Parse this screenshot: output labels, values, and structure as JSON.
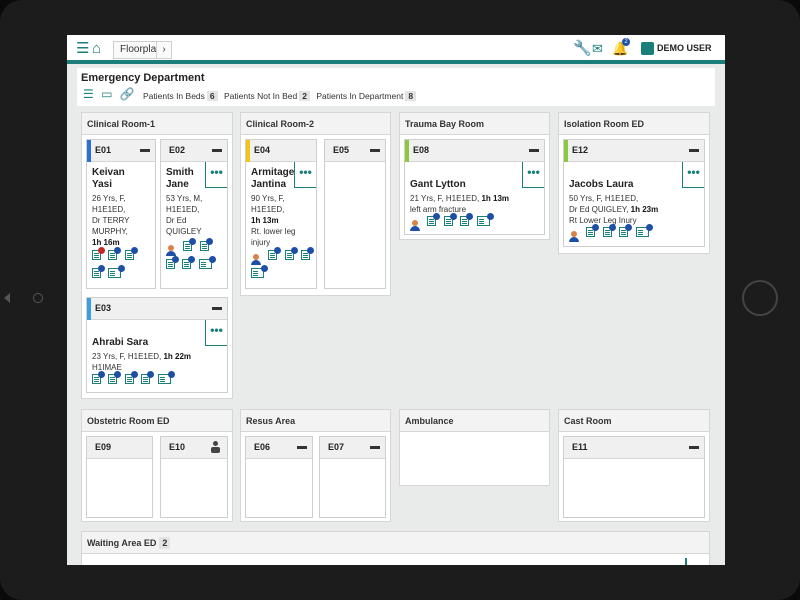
{
  "topbar": {
    "breadcrumb": "Floorplan",
    "breadcrumb_arrow": "›",
    "notification_count": "2",
    "user": "DEMO USER"
  },
  "department": {
    "title": "Emergency Department"
  },
  "stats": [
    {
      "label": "Patients In Beds",
      "count": "6"
    },
    {
      "label": "Patients Not In Bed",
      "count": "2"
    },
    {
      "label": "Patients In Department",
      "count": "8"
    }
  ],
  "rooms": {
    "clinical1": {
      "name": "Clinical Room-1"
    },
    "clinical2": {
      "name": "Clinical Room-2"
    },
    "trauma": {
      "name": "Trauma Bay Room"
    },
    "isolation": {
      "name": "Isolation Room ED"
    },
    "obstetric": {
      "name": "Obstetric Room ED"
    },
    "resus": {
      "name": "Resus Area"
    },
    "ambulance": {
      "name": "Ambulance"
    },
    "cast": {
      "name": "Cast Room"
    },
    "waiting": {
      "name": "Waiting Area ED",
      "count": "2"
    }
  },
  "beds": {
    "E01": {
      "code": "E01",
      "color": "#2c6fd6",
      "name1": "Keivan",
      "name2": "Yasi",
      "info": [
        "26 Yrs, F,",
        "H1E1ED,",
        "Dr TERRY",
        "MURPHY,"
      ],
      "time": "1h 16m"
    },
    "E02": {
      "code": "E02",
      "name1": "Smith",
      "name2": "Jane",
      "info": [
        "53 Yrs, M,",
        "H1E1ED,",
        "Dr Ed",
        "QUIGLEY"
      ]
    },
    "E03": {
      "code": "E03",
      "color": "#3d9fe0",
      "name1": "Ahrabi Sara",
      "info_prefix": "23 Yrs, F, H1E1ED,",
      "time": "1h 22m",
      "info_line2": "H1IMAE"
    },
    "E04": {
      "code": "E04",
      "color": "#f2c417",
      "name1": "Armitage",
      "name2": "Jantina",
      "info": [
        "90 Yrs, F,",
        "H1E1ED,"
      ],
      "time": "1h 13m",
      "info2": [
        "Rt. lower leg",
        "injury"
      ]
    },
    "E05": {
      "code": "E05"
    },
    "E08": {
      "code": "E08",
      "color": "#8dc63f",
      "name1": "Gant Lytton",
      "info_prefix": "21 Yrs, F, H1E1ED,",
      "time": "1h 13m",
      "info_line2": "left arm fracture"
    },
    "E12": {
      "code": "E12",
      "color": "#8dc63f",
      "name1": "Jacobs Laura",
      "info_line1": "50 Yrs, F, H1E1ED,",
      "info_prefix": "Dr Ed QUIGLEY,",
      "time": "1h 23m",
      "info_line3": "Rt Lower Leg Inury"
    },
    "E09": {
      "code": "E09"
    },
    "E10": {
      "code": "E10"
    },
    "E06": {
      "code": "E06"
    },
    "E07": {
      "code": "E07"
    },
    "E11": {
      "code": "E11"
    }
  },
  "icons": {
    "bed": "bed-icon",
    "menu": "•••",
    "colors": {
      "accent": "#1a7f7a",
      "badge": "#1d4fa6",
      "alert": "#c62828"
    }
  }
}
